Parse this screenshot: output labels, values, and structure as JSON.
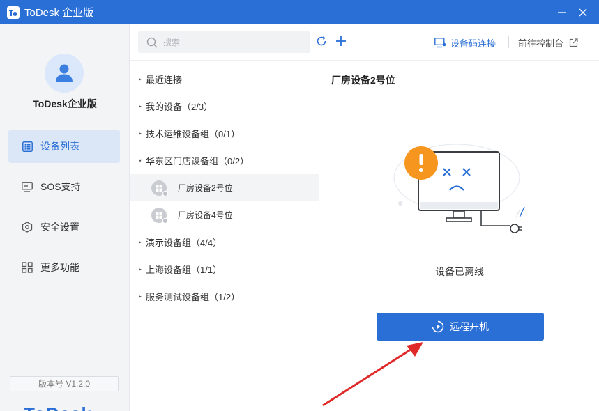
{
  "titlebar": {
    "title": "ToDesk 企业版",
    "icons": [
      "app-logo-icon",
      "minimize-icon",
      "close-icon"
    ]
  },
  "sidebar": {
    "org_name": "ToDesk企业版",
    "items": [
      {
        "label": "设备列表",
        "icon": "list-icon",
        "active": true
      },
      {
        "label": "SOS支持",
        "icon": "monitor-icon",
        "active": false
      },
      {
        "label": "安全设置",
        "icon": "hexagon-settings-icon",
        "active": false
      },
      {
        "label": "更多功能",
        "icon": "grid-icon",
        "active": false
      }
    ],
    "version": "版本号 V1.2.0",
    "brand_partial": "ToDesk"
  },
  "toolbar": {
    "search_placeholder": "搜索",
    "code_connect": "设备码连接",
    "console": "前往控制台"
  },
  "tree": {
    "groups": [
      {
        "label": "最近连接",
        "expanded": false
      },
      {
        "label": "我的设备（2/3）",
        "expanded": false
      },
      {
        "label": "技术运维设备组（0/1）",
        "expanded": false
      },
      {
        "label": "华东区门店设备组（0/2）",
        "expanded": true
      },
      {
        "label": "演示设备组（4/4）",
        "expanded": false
      },
      {
        "label": "上海设备组（1/1）",
        "expanded": false
      },
      {
        "label": "服务测试设备组（1/2）",
        "expanded": false
      }
    ],
    "devices": [
      {
        "label": "厂房设备2号位",
        "selected": true
      },
      {
        "label": "厂房设备4号位",
        "selected": false
      }
    ]
  },
  "detail": {
    "title": "厂房设备2号位",
    "status": "设备已离线",
    "action": "远程开机"
  },
  "colors": {
    "accent": "#2a6fd6",
    "warning": "#f7961e",
    "annotation_arrow": "#e02a2a"
  }
}
